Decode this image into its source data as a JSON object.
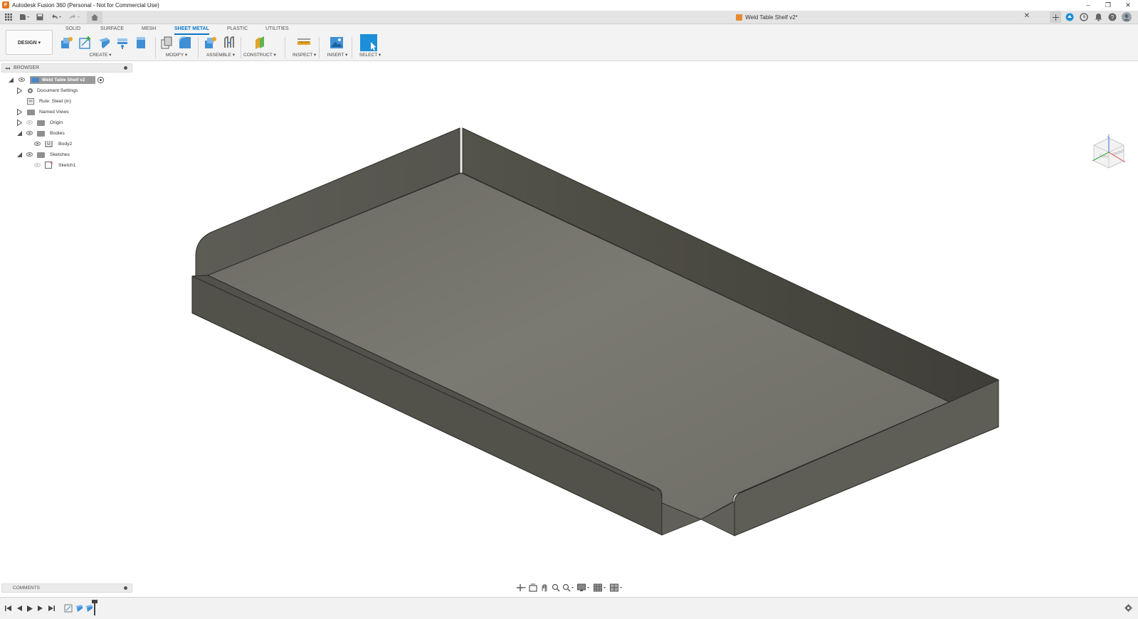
{
  "window": {
    "title": "Autodesk Fusion 360 (Personal - Not for Commercial Use)",
    "minimize": "–",
    "restore": "❐",
    "close": "✕"
  },
  "document_tab": {
    "title": "Weld Table Shelf v2*",
    "close": "✕"
  },
  "workspace": {
    "label": "DESIGN ▾"
  },
  "tabs": [
    {
      "label": "SOLID"
    },
    {
      "label": "SURFACE"
    },
    {
      "label": "MESH"
    },
    {
      "label": "SHEET METAL"
    },
    {
      "label": "PLASTIC"
    },
    {
      "label": "UTILITIES"
    }
  ],
  "groups": {
    "create": "CREATE ▾",
    "modify": "MODIFY ▾",
    "assemble": "ASSEMBLE ▾",
    "construct": "CONSTRUCT ▾",
    "inspect": "INSPECT ▾",
    "insert": "INSERT ▾",
    "select": "SELECT ▾"
  },
  "browser": {
    "title": "BROWSER",
    "collapse": "◂◂",
    "root": "Weld Table Shelf v2",
    "items": [
      {
        "label": "Document Settings"
      },
      {
        "label": "Rule: Steel (in)"
      },
      {
        "label": "Named Views"
      },
      {
        "label": "Origin"
      },
      {
        "label": "Bodies"
      },
      {
        "label": "Body2"
      },
      {
        "label": "Sketches"
      },
      {
        "label": "Sketch1"
      }
    ]
  },
  "comments": {
    "title": "COMMENTS"
  },
  "colors": {
    "accent": "#0a78c8",
    "shelf_top": "#75736a",
    "shelf_wall_dark": "#48473f",
    "shelf_wall_light": "#5e5d56"
  }
}
